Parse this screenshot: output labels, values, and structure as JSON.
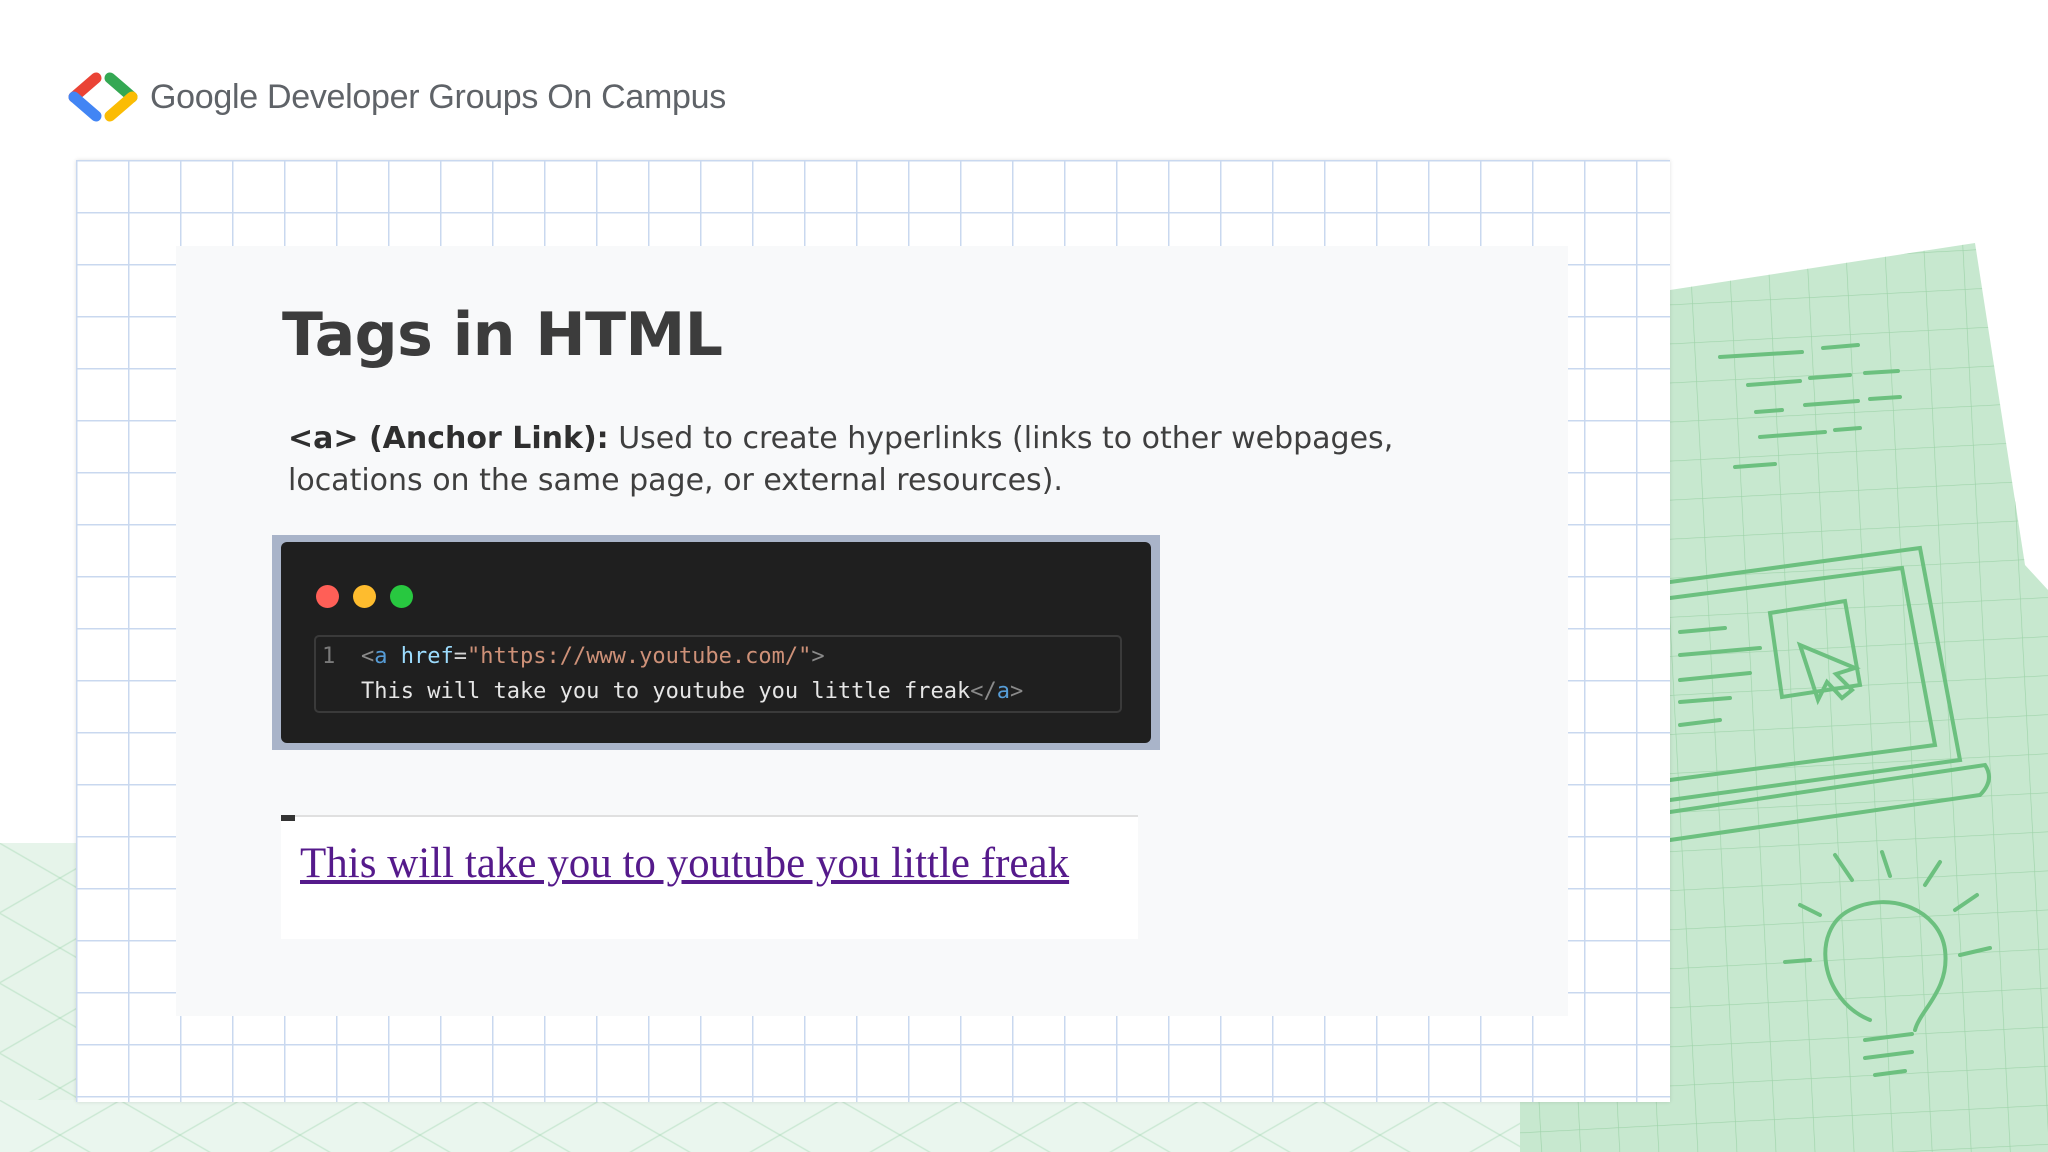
{
  "header": {
    "brand_text": "Google Developer Groups On Campus",
    "logo_icon": "gdg-brackets-icon"
  },
  "slide": {
    "title": "Tags in HTML",
    "description": {
      "term": "<a> (Anchor Link):",
      "text": " Used to create hyperlinks (links to other webpages, locations on the same page, or external resources)."
    },
    "code": {
      "line_number": "1",
      "open_bracket": "<",
      "tag": "a",
      "attr": " href",
      "eq": "=",
      "value": "\"https://www.youtube.com/\"",
      "close_bracket": ">",
      "body": "This will take you to youtube you little freak",
      "end_open": "</",
      "end_tag": "a",
      "end_close": ">"
    },
    "output_link_text": "This will take you to youtube you little freak"
  },
  "colors": {
    "title": "#3c3c3c",
    "link_visited": "#551a8b",
    "code_bg": "#1f1f1f",
    "accent_green": "#81c995"
  }
}
